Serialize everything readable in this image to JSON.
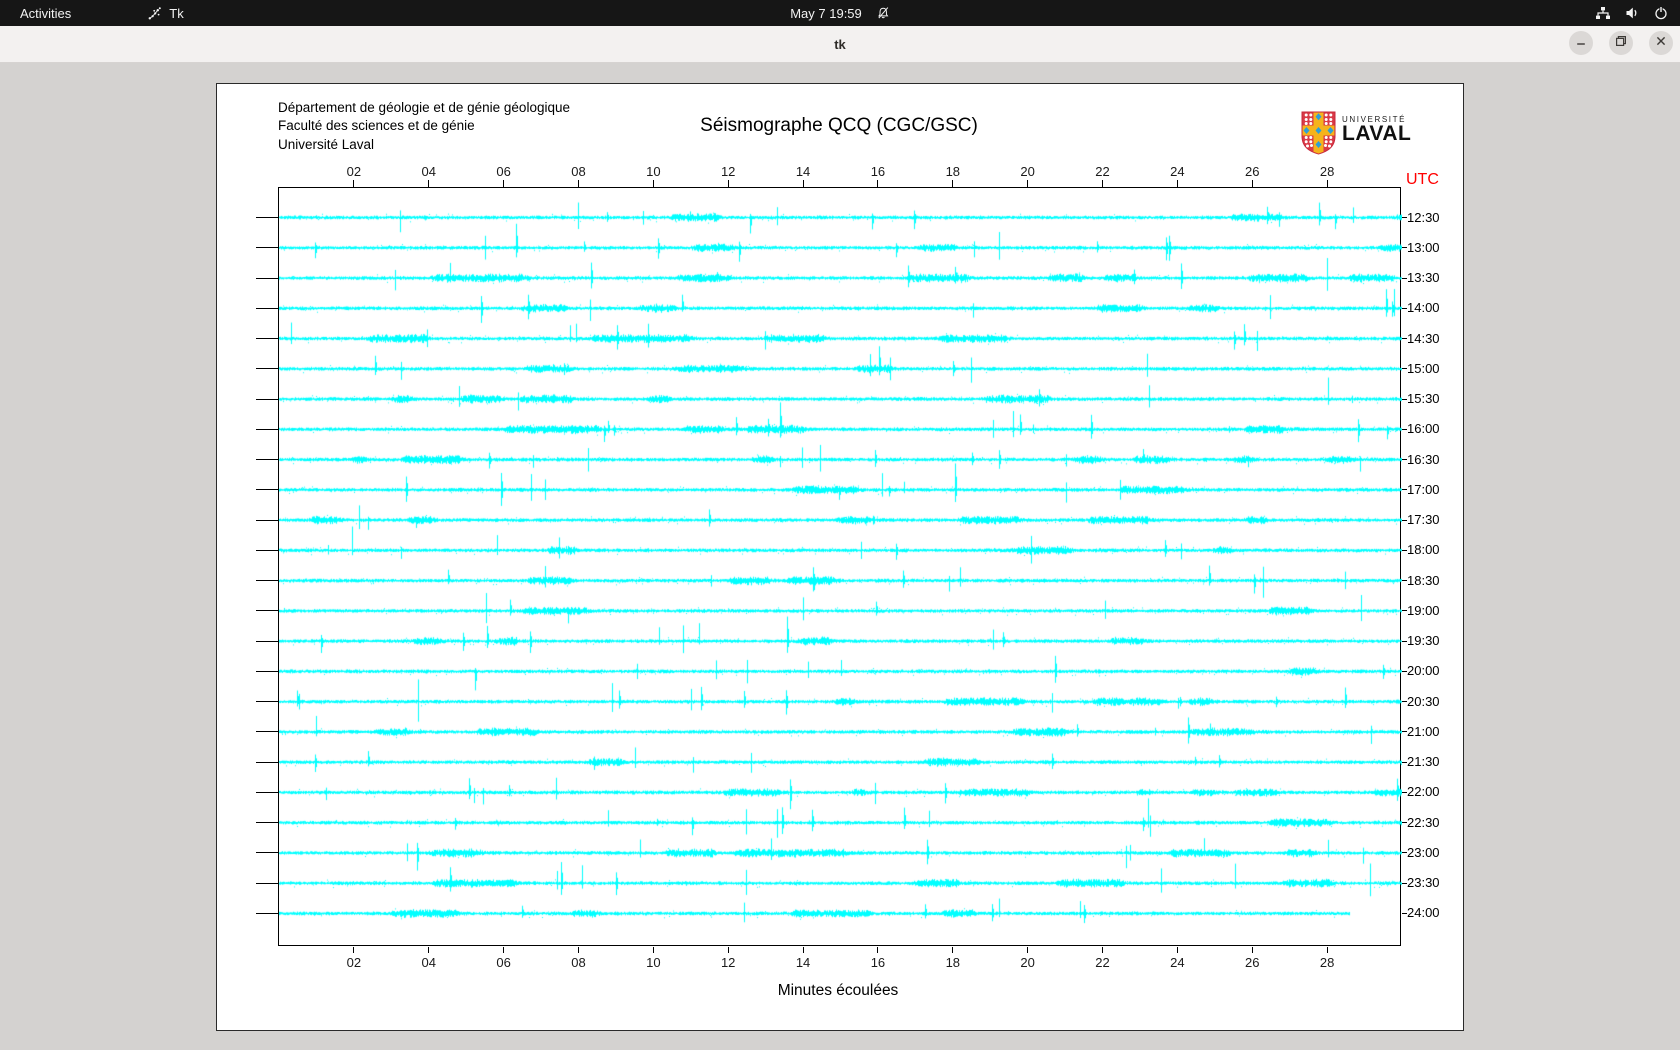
{
  "topbar": {
    "activities_label": "Activities",
    "app_name": "Tk",
    "clock": "May 7 19:59",
    "status_icons": [
      "notifications-muted",
      "network-wired",
      "volume",
      "power"
    ]
  },
  "titlebar": {
    "title": "tk",
    "controls": [
      "minimize",
      "maximize",
      "close"
    ]
  },
  "seismograph": {
    "institution_lines": {
      "0": "Département de géologie et de génie géologique",
      "1": "Faculté des sciences et de génie",
      "2": "Université Laval"
    },
    "title": "Séismographe QCQ (CGC/GSC)",
    "logo": {
      "line_small": "UNIVERSITÉ",
      "line_big": "LAVAL"
    },
    "utc_label": "UTC",
    "utc_color": "#ff0000",
    "x_axis_title": "Minutes écoulées",
    "trace_color": "#00ffff"
  },
  "chart_data": {
    "type": "line",
    "subtype": "helicorder-seismograph",
    "title": "Séismographe QCQ (CGC/GSC)",
    "xlabel": "Minutes écoulées",
    "right_axis_label": "UTC",
    "x_range_minutes": [
      0,
      30
    ],
    "x_tick_step": 2,
    "x_tick_labels": [
      "02",
      "04",
      "06",
      "08",
      "10",
      "12",
      "14",
      "16",
      "18",
      "20",
      "22",
      "24",
      "26",
      "28"
    ],
    "row_labels": [
      "12:30",
      "13:00",
      "13:30",
      "14:00",
      "14:30",
      "15:00",
      "15:30",
      "16:00",
      "16:30",
      "17:00",
      "17:30",
      "18:00",
      "18:30",
      "19:00",
      "19:30",
      "20:00",
      "20:30",
      "21:00",
      "21:30",
      "22:00",
      "22:30",
      "23:00",
      "23:30",
      "24:00"
    ],
    "row_interval_minutes": 30,
    "last_row_end_minute": 28.6,
    "trace_color": "#00ffff",
    "grid": false,
    "waveform_note": "continuous seismic background noise with random transient spikes; amplitude ±1-3 px noise band, spikes up to ±25 px"
  }
}
